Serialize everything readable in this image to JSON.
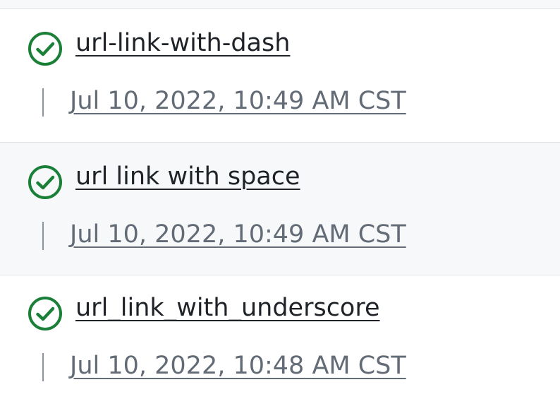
{
  "colors": {
    "success": "#1a7f37",
    "title_text": "#1f2328",
    "muted_text": "#636c76",
    "divider": "#dfe3e8"
  },
  "items": [
    {
      "icon": "check-circle-icon",
      "status": "success",
      "title": "url-link-with-dash",
      "time": "Jul 10, 2022, 10:49 AM CST"
    },
    {
      "icon": "check-circle-icon",
      "status": "success",
      "title": "url link with space",
      "time": "Jul 10, 2022, 10:49 AM CST"
    },
    {
      "icon": "check-circle-icon",
      "status": "success",
      "title": "url_link_with_underscore",
      "time": "Jul 10, 2022, 10:48 AM CST"
    }
  ]
}
